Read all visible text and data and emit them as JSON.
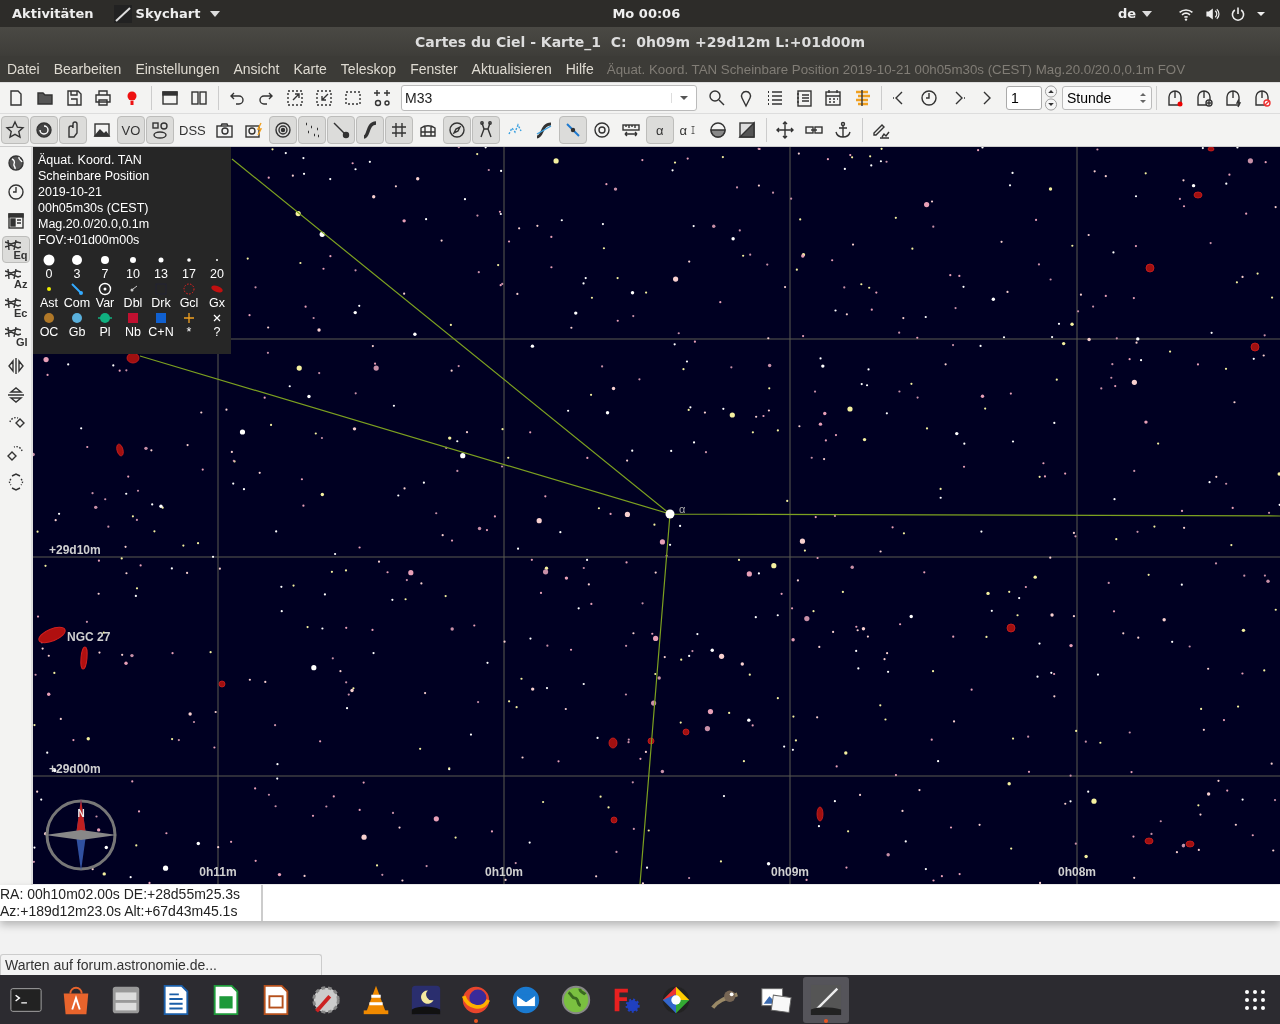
{
  "top_bar": {
    "activities": "Aktivitäten",
    "app_menu": "Skychart",
    "clock": "Mo 00:06",
    "language": "de"
  },
  "window": {
    "title": "Cartes du Ciel - Karte_1  C:  0h09m +29d12m L:+01d00m"
  },
  "menu": [
    "Datei",
    "Bearbeiten",
    "Einstellungen",
    "Ansicht",
    "Karte",
    "Teleskop",
    "Fenster",
    "Aktualisieren",
    "Hilfe"
  ],
  "chart_info": "Äquat. Koord. TAN Scheinbare Position 2019-10-21 00h05m30s (CEST) Mag.20.0/20.0,0.1m FOV",
  "toolbar_1": {
    "search_value": "M33",
    "step": "1",
    "unit": "Stunde"
  },
  "toolbar_2": [
    {
      "pressed": true
    },
    {
      "pressed": true
    },
    {
      "pressed": true
    },
    {
      "pressed": false
    },
    {
      "pressed": true,
      "label": "VO"
    },
    {
      "pressed": true
    },
    {
      "pressed": false,
      "label": "DSS"
    },
    {
      "pressed": false
    },
    {
      "pressed": false
    },
    {
      "pressed": true
    },
    {
      "pressed": true
    },
    {
      "pressed": true
    },
    {
      "pressed": true
    },
    {
      "pressed": true
    },
    {
      "pressed": false
    },
    {
      "pressed": true
    },
    {
      "pressed": true
    },
    {
      "pressed": false
    },
    {
      "pressed": false
    },
    {
      "pressed": true
    },
    {
      "pressed": false
    },
    {
      "pressed": false
    },
    {
      "pressed": true,
      "label": "α"
    },
    {
      "pressed": false,
      "label": "α"
    },
    {
      "pressed": false
    },
    {
      "pressed": false
    },
    {
      "pressed": false
    },
    {
      "pressed": false
    },
    {
      "pressed": false
    },
    {
      "pressed": false
    }
  ],
  "left_toolbar": [
    {
      "pressed": false
    },
    {
      "pressed": false
    },
    {
      "pressed": false
    },
    {
      "pressed": true,
      "label": "Eq"
    },
    {
      "pressed": false,
      "label": "Az"
    },
    {
      "pressed": false,
      "label": "Ec"
    },
    {
      "pressed": false,
      "label": "Gl"
    },
    {
      "pressed": false
    },
    {
      "pressed": false
    },
    {
      "pressed": false
    },
    {
      "pressed": false
    },
    {
      "pressed": false
    }
  ],
  "legend": {
    "lines": [
      "Äquat. Koord. TAN",
      "Scheinbare Position",
      "2019-10-21",
      "00h05m30s (CEST)",
      "Mag.20.0/20.0,0.1m",
      "FOV:+01d00m00s"
    ],
    "magnitudes": [
      "0",
      "3",
      "7",
      "10",
      "13",
      "17",
      "20"
    ],
    "object_rows": [
      [
        "Ast",
        "Com",
        "Var",
        "Dbl",
        "Drk",
        "Gcl",
        "Gx"
      ],
      [
        "OC",
        "Gb",
        "Pl",
        "Nb",
        "C+N",
        "*",
        "?"
      ]
    ]
  },
  "chart": {
    "dec_labels": [
      "+29d10m",
      "+29d00m"
    ],
    "ra_labels": [
      "0h11m",
      "0h10m",
      "0h09m",
      "0h08m"
    ],
    "object_label": "NGC 27",
    "star_label": "α",
    "compass_north": "N"
  },
  "status": {
    "line_1": "RA: 00h10m02.00s DE:+28d55m25.3s",
    "line_2": "Az:+189d12m23.0s Alt:+67d43m45.1s"
  },
  "loading_status": "Warten auf forum.astronomie.de...",
  "taskbar": [
    {
      "running": false,
      "selected": false
    },
    {
      "running": false,
      "selected": false
    },
    {
      "running": false,
      "selected": false
    },
    {
      "running": false,
      "selected": false
    },
    {
      "running": false,
      "selected": false
    },
    {
      "running": false,
      "selected": false
    },
    {
      "running": false,
      "selected": false
    },
    {
      "running": false,
      "selected": false
    },
    {
      "running": false,
      "selected": false
    },
    {
      "running": true,
      "selected": false
    },
    {
      "running": false,
      "selected": false
    },
    {
      "running": false,
      "selected": false
    },
    {
      "running": false,
      "selected": false
    },
    {
      "running": false,
      "selected": false
    },
    {
      "running": false,
      "selected": false
    },
    {
      "running": false,
      "selected": false
    },
    {
      "running": true,
      "selected": true
    }
  ]
}
